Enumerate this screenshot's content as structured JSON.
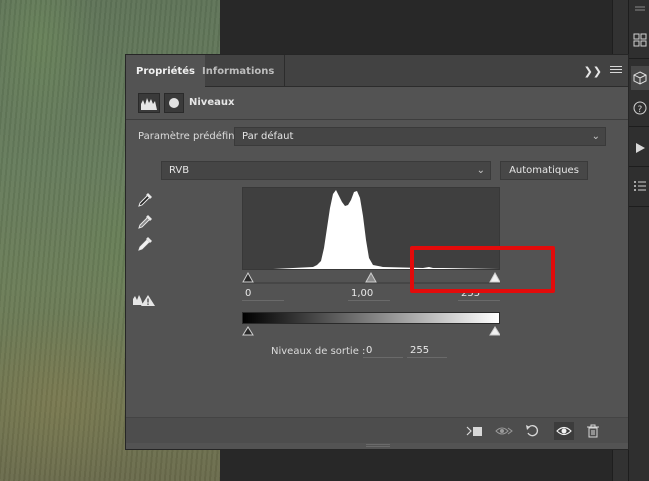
{
  "panel": {
    "tabs": [
      {
        "label": "Propriétés",
        "active": true
      },
      {
        "label": "Informations",
        "active": false
      }
    ],
    "header_title": "Niveaux",
    "preset": {
      "label": "Paramètre prédéfini :",
      "value": "Par défaut"
    },
    "channel": {
      "value": "RVB"
    },
    "auto_button": "Automatiques",
    "input_levels": {
      "black": "0",
      "gamma": "1,00",
      "white": "255"
    },
    "output_levels": {
      "label": "Niveaux de sortie :",
      "black": "0",
      "white": "255"
    }
  },
  "icons": {
    "tab_overflow": "double-chevron-right-icon",
    "panel_menu": "hamburger-icon",
    "eyedroppers": [
      "black-eyedropper-icon",
      "gray-eyedropper-icon",
      "white-eyedropper-icon"
    ],
    "warning": "clipping-warning-icon",
    "bottom": [
      "clip-to-layer-icon",
      "view-previous-state-icon",
      "reset-icon",
      "visibility-eye-icon",
      "trash-icon"
    ]
  },
  "colors": {
    "panel_bg": "#535353",
    "tab_bg": "#424242",
    "highlight_box": "#e30b0b"
  }
}
